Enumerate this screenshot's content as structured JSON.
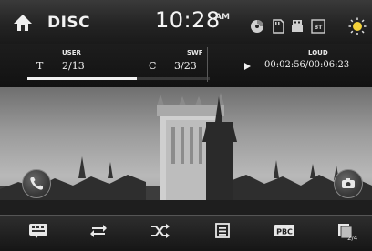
{
  "header": {
    "source_title": "DISC",
    "clock": "10:28",
    "ampm": "AM",
    "status_icons": [
      "disc-icon",
      "sd-card-icon",
      "usb-icon",
      "bluetooth-icon",
      "brightness-icon"
    ]
  },
  "info": {
    "user_label": "USER",
    "swf_label": "SWF",
    "loud_label": "LOUD",
    "track_prefix": "T",
    "track_value": "2/13",
    "chapter_prefix": "C",
    "chapter_value": "3/23",
    "time": "00:02:56/00:06:23",
    "progress": 0.6
  },
  "side_buttons": [
    "phone-icon",
    "camera-switch-icon"
  ],
  "bottom": {
    "buttons": [
      "subtitle-icon",
      "repeat-icon",
      "shuffle-icon",
      "playlist-icon",
      "audio-track-icon",
      "page-icon"
    ],
    "page_indicator": "2/4"
  }
}
